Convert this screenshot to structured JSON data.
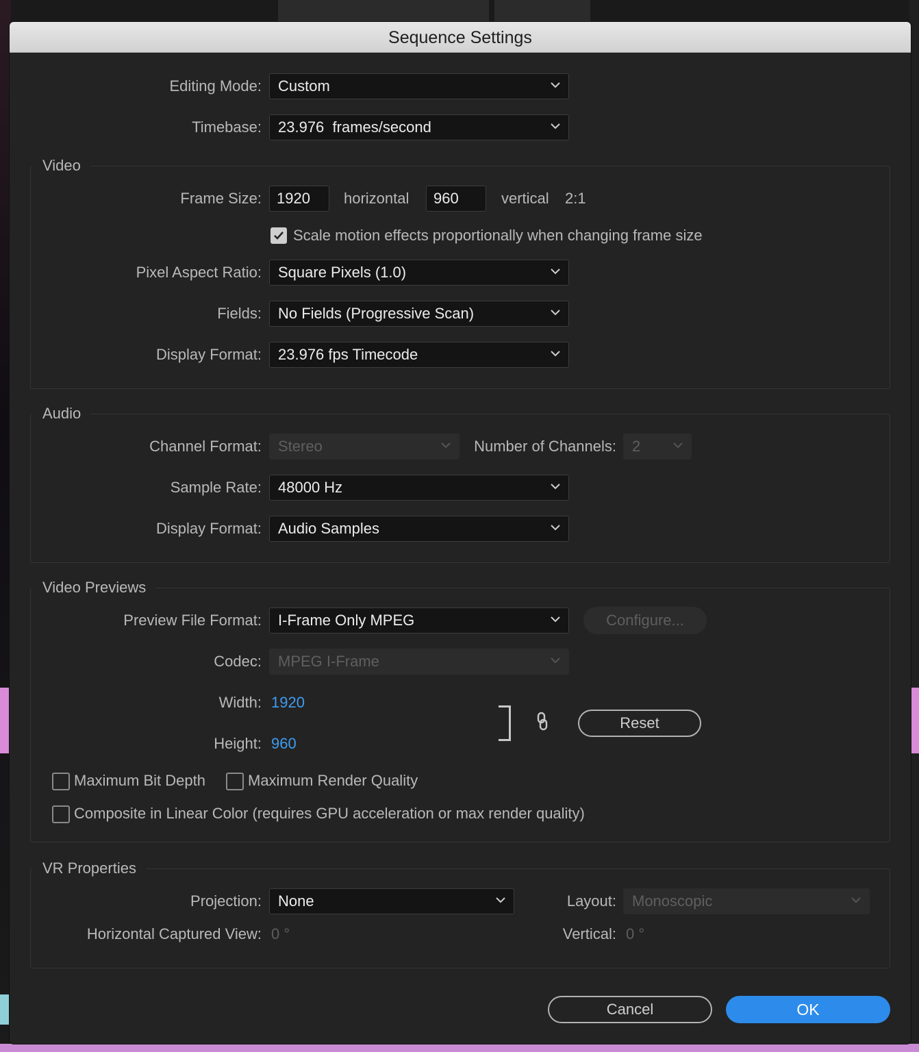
{
  "dialog": {
    "title": "Sequence Settings",
    "editing_mode": {
      "label": "Editing Mode:",
      "value": "Custom"
    },
    "timebase": {
      "label": "Timebase:",
      "value": "23.976  frames/second"
    }
  },
  "video": {
    "title": "Video",
    "frame_size": {
      "label": "Frame Size:",
      "width": "1920",
      "horizontal_label": "horizontal",
      "height": "960",
      "vertical_label": "vertical",
      "ratio": "2:1"
    },
    "scale_motion": {
      "label": "Scale motion effects proportionally when changing frame size",
      "checked": true
    },
    "pixel_aspect": {
      "label": "Pixel Aspect Ratio:",
      "value": "Square Pixels (1.0)"
    },
    "fields": {
      "label": "Fields:",
      "value": "No Fields (Progressive Scan)"
    },
    "display_format": {
      "label": "Display Format:",
      "value": "23.976 fps Timecode"
    }
  },
  "audio": {
    "title": "Audio",
    "channel_format": {
      "label": "Channel Format:",
      "value": "Stereo"
    },
    "num_channels": {
      "label": "Number of Channels:",
      "value": "2"
    },
    "sample_rate": {
      "label": "Sample Rate:",
      "value": "48000 Hz"
    },
    "display_format": {
      "label": "Display Format:",
      "value": "Audio Samples"
    }
  },
  "previews": {
    "title": "Video Previews",
    "file_format": {
      "label": "Preview File Format:",
      "value": "I-Frame Only MPEG"
    },
    "configure_label": "Configure...",
    "codec": {
      "label": "Codec:",
      "value": "MPEG I-Frame"
    },
    "width": {
      "label": "Width:",
      "value": "1920"
    },
    "height": {
      "label": "Height:",
      "value": "960"
    },
    "reset_label": "Reset",
    "max_bit_depth": {
      "label": "Maximum Bit Depth",
      "checked": false
    },
    "max_render_quality": {
      "label": "Maximum Render Quality",
      "checked": false
    },
    "linear_color": {
      "label": "Composite in Linear Color (requires GPU acceleration or max render quality)",
      "checked": false
    }
  },
  "vr": {
    "title": "VR Properties",
    "projection": {
      "label": "Projection:",
      "value": "None"
    },
    "layout": {
      "label": "Layout:",
      "value": "Monoscopic"
    },
    "h_view": {
      "label": "Horizontal Captured View:",
      "value": "0 °"
    },
    "v_view": {
      "label": "Vertical:",
      "value": "0 °"
    }
  },
  "buttons": {
    "cancel": "Cancel",
    "ok": "OK"
  },
  "colors": {
    "accent": "#2d8ceb",
    "link_value": "#3f9cf0",
    "dialog_bg": "#232323",
    "titlebar": "#dcdcdc"
  }
}
